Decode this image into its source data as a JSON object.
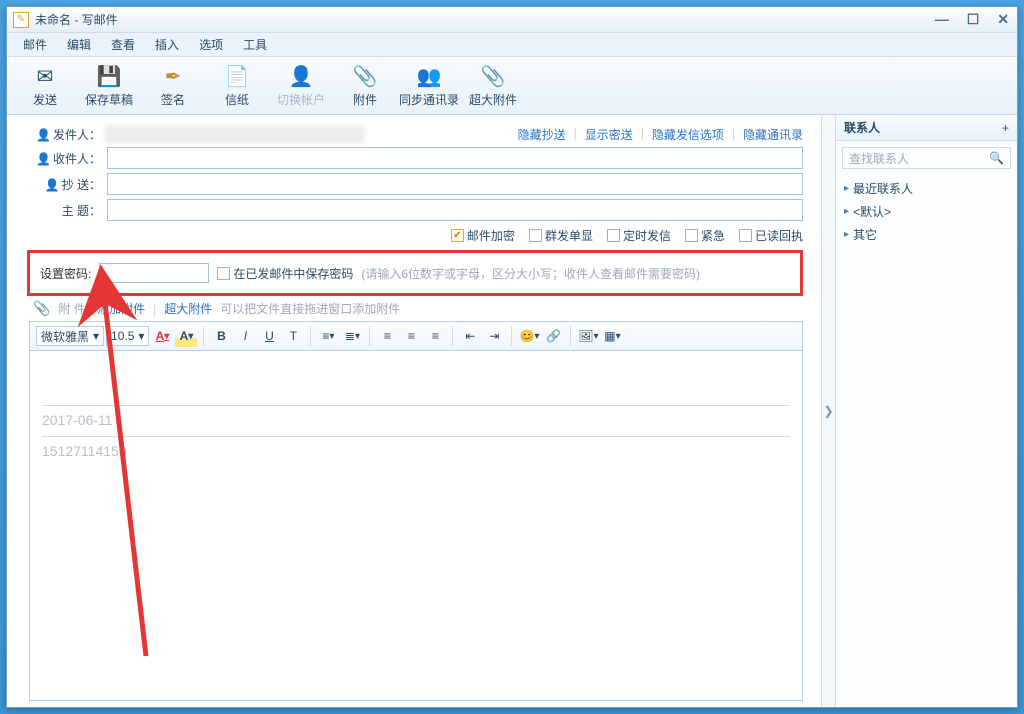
{
  "window": {
    "title": "未命名 - 写邮件"
  },
  "menu": {
    "mail": "邮件",
    "edit": "编辑",
    "view": "查看",
    "insert": "插入",
    "options": "选项",
    "tools": "工具"
  },
  "toolbar": {
    "send": "发送",
    "save_draft": "保存草稿",
    "signature": "签名",
    "stationery": "信纸",
    "switch_account": "切换帐户",
    "attach": "附件",
    "sync_contacts": "同步通讯录",
    "big_attach": "超大附件"
  },
  "links": {
    "hide_bcc": "隐藏抄送",
    "show_bcc": "显示密送",
    "hide_send_opts": "隐藏发信选项",
    "hide_contacts": "隐藏通讯录"
  },
  "fields": {
    "sender": "发件人：",
    "to": "收件人：",
    "cc": "抄  送：",
    "subject": "主  题："
  },
  "checks": {
    "encrypt": "邮件加密",
    "separate": "群发单显",
    "schedule": "定时发信",
    "urgent": "紧急",
    "receipt": "已读回执"
  },
  "password": {
    "label": "设置密码:",
    "save_chk": "在已发邮件中保存密码",
    "hint": "(请输入6位数字或字母，区分大小写；收件人查看邮件需要密码)"
  },
  "attach": {
    "label": "附  件:",
    "add": "添加附件",
    "big": "超大附件",
    "hint": "可以把文件直接拖进窗口添加附件"
  },
  "editor": {
    "font": "微软雅黑",
    "size": "10.5",
    "body_date": "2017-06-11",
    "body_phone": "15127114150"
  },
  "contacts": {
    "title": "联系人",
    "search_ph": "查找联系人",
    "recent": "最近联系人",
    "default": "<默认>",
    "other": "其它"
  }
}
